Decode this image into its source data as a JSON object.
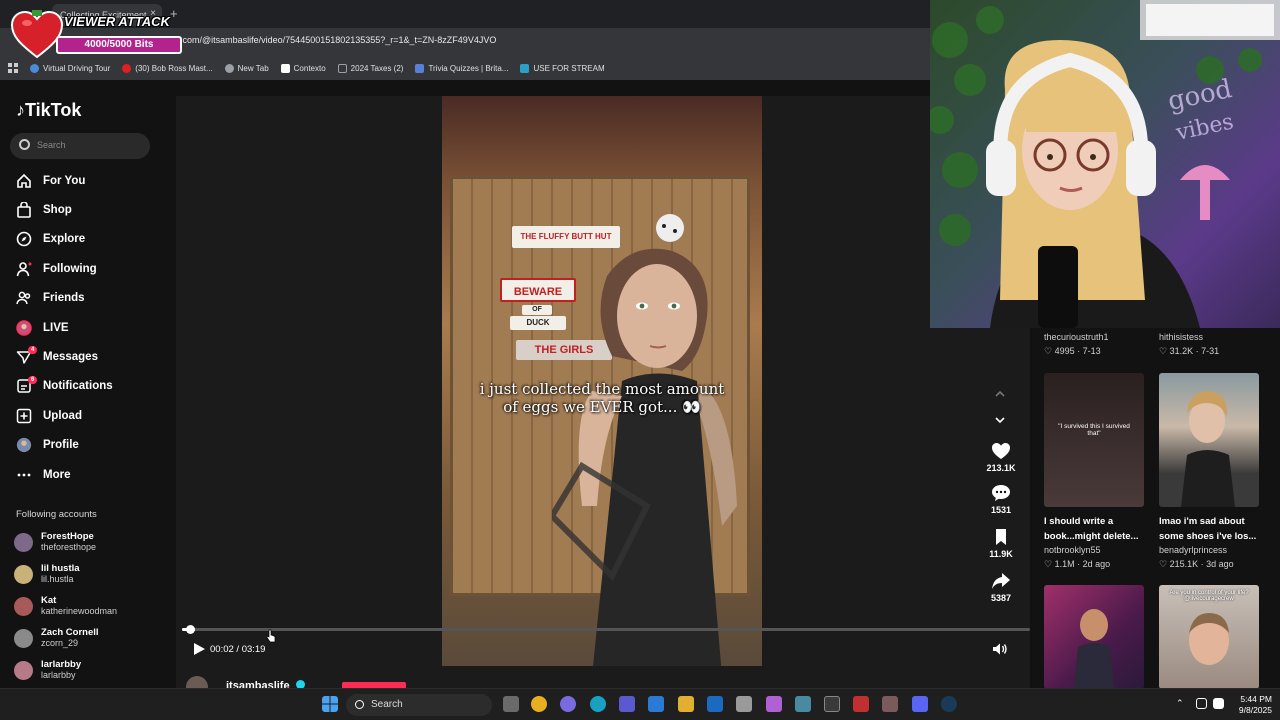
{
  "browser": {
    "tab_title": "Collecting Excitement",
    "tab_close": "×",
    "new_tab": "+",
    "url": ".com/@itsambaslife/video/7544500151802135355?_r=1&_t=ZN-8zZF49V4JVO",
    "bookmarks": [
      {
        "label": "Virtual Driving Tour",
        "icon": "globe-icon",
        "color": "#4a8bd6"
      },
      {
        "label": "(30) Bob Ross Mast...",
        "icon": "youtube-icon",
        "color": "#e02020"
      },
      {
        "label": "New Tab",
        "icon": "chrome-icon",
        "color": "#9aa0a6"
      },
      {
        "label": "Contexto",
        "icon": "contexto-icon",
        "color": "#ffffff"
      },
      {
        "label": "2024 Taxes (2)",
        "icon": "folder-icon",
        "color": "#9aa0a6"
      },
      {
        "label": "Trivia Quizzes | Brita...",
        "icon": "britannica-icon",
        "color": "#5a7fd6"
      },
      {
        "label": "USE FOR STREAM",
        "icon": "bookmark-p-icon",
        "color": "#2aa0c9"
      }
    ]
  },
  "overlay": {
    "title": "VIEWER ATTACK",
    "bits": "4000/5000 Bits"
  },
  "tiktok": {
    "logo": "TikTok",
    "search_placeholder": "Search",
    "nav": [
      {
        "label": "For You",
        "icon": "home-icon",
        "badge": ""
      },
      {
        "label": "Shop",
        "icon": "shop-icon",
        "badge": ""
      },
      {
        "label": "Explore",
        "icon": "compass-icon",
        "badge": ""
      },
      {
        "label": "Following",
        "icon": "following-icon",
        "badge": ""
      },
      {
        "label": "Friends",
        "icon": "friends-icon",
        "badge": ""
      },
      {
        "label": "LIVE",
        "icon": "live-icon",
        "badge": ""
      },
      {
        "label": "Messages",
        "icon": "messages-icon",
        "badge": "4"
      },
      {
        "label": "Notifications",
        "icon": "bell-icon",
        "badge": "6"
      },
      {
        "label": "Upload",
        "icon": "upload-icon",
        "badge": ""
      },
      {
        "label": "Profile",
        "icon": "profile-icon",
        "badge": ""
      },
      {
        "label": "More",
        "icon": "more-icon",
        "badge": ""
      }
    ],
    "following_title": "Following accounts",
    "following": [
      {
        "name": "ForestHope",
        "user": "theforesthope"
      },
      {
        "name": "lil hustla",
        "user": "lil.hustla"
      },
      {
        "name": "Kat",
        "user": "katherinewoodman"
      },
      {
        "name": "Zach Cornell",
        "user": "zcorn_29"
      },
      {
        "name": "larlarbby",
        "user": "larlarbby"
      }
    ],
    "video": {
      "caption": "i just collected the most amount of eggs we EVER got... 👀",
      "sign_1": "THE FLUFFY BUTT HUT",
      "sign_2": "BEWARE",
      "sign_3": "OF",
      "sign_4": "DUCK",
      "sign_5": "THE GIRLS",
      "time": "00:02 / 03:19",
      "progress": 0.01
    },
    "actions": {
      "likes": "213.1K",
      "comments": "1531",
      "saves": "11.9K",
      "shares": "5387"
    },
    "author": "itsambaslife"
  },
  "suggestions": {
    "row0": [
      {
        "user": "thecurioustruth1",
        "likes": "4995",
        "date": "7-13"
      },
      {
        "user": "hithisistess",
        "likes": "31.2K",
        "date": "7-31"
      }
    ],
    "row1": [
      {
        "title": "I should write a book...might delete...",
        "user": "notbrooklyn55",
        "likes": "1.1M",
        "date": "2d ago",
        "overlay": "\"I survived this I survived that\""
      },
      {
        "title": "lmao i'm sad about some shoes i've los...",
        "user": "benadyrlprincess",
        "likes": "215.1K",
        "date": "3d ago",
        "overlay": ""
      }
    ],
    "row2": [
      {
        "overlay": ""
      },
      {
        "overlay": "Are you in control of your life? @livecouragecrew"
      }
    ]
  },
  "taskbar": {
    "search": "Search",
    "time": "5:44 PM",
    "date": "9/8/2025"
  }
}
